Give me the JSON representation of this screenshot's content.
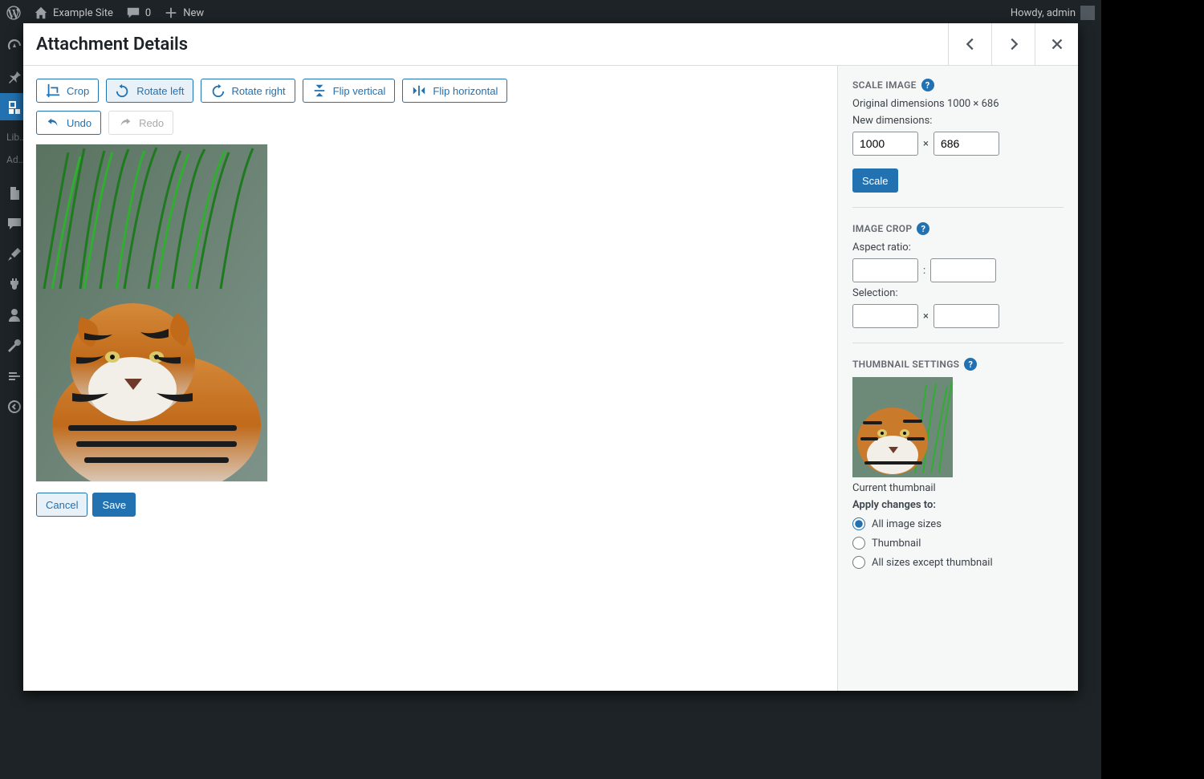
{
  "adminbar": {
    "site_name": "Example Site",
    "comments_count": "0",
    "new_label": "New",
    "howdy": "Howdy, admin"
  },
  "sidebar_labels": {
    "library": "Lib…",
    "add": "Ad…"
  },
  "modal": {
    "title": "Attachment Details"
  },
  "toolbar": {
    "crop": "Crop",
    "rotate_left": "Rotate left",
    "rotate_right": "Rotate right",
    "flip_vertical": "Flip vertical",
    "flip_horizontal": "Flip horizontal",
    "undo": "Undo",
    "redo": "Redo"
  },
  "actions": {
    "cancel": "Cancel",
    "save": "Save"
  },
  "scale": {
    "heading": "SCALE IMAGE",
    "original": "Original dimensions 1000 × 686",
    "new_label": "New dimensions:",
    "width": "1000",
    "height": "686",
    "sep": "×",
    "button": "Scale"
  },
  "crop": {
    "heading": "IMAGE CROP",
    "aspect_label": "Aspect ratio:",
    "aspect_sep": ":",
    "selection_label": "Selection:",
    "selection_sep": "×"
  },
  "thumb": {
    "heading": "THUMBNAIL SETTINGS",
    "current": "Current thumbnail",
    "apply_label": "Apply changes to:",
    "opt_all": "All image sizes",
    "opt_thumb": "Thumbnail",
    "opt_except": "All sizes except thumbnail"
  }
}
